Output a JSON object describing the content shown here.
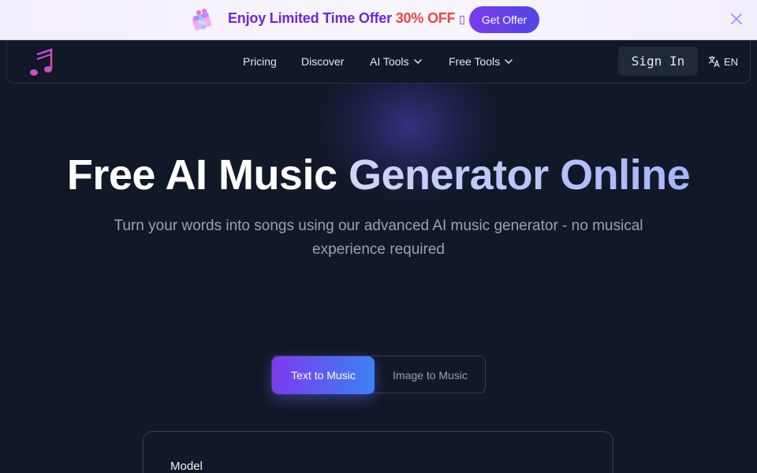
{
  "promo": {
    "text_main": "Enjoy Limited Time Offer ",
    "text_discount": "30% OFF",
    "text_glyph": "▯",
    "button_label": "Get Offer",
    "accent_color": "#6d28d9",
    "discount_color": "#ef4444"
  },
  "nav": {
    "links": [
      {
        "label": "Pricing"
      },
      {
        "label": "Discover"
      },
      {
        "label": "AI Tools"
      },
      {
        "label": "Free Tools"
      }
    ],
    "signin_label": "Sign In",
    "lang_label": "EN"
  },
  "hero": {
    "title_plain": "Free AI Music ",
    "title_gradient": "Generator Online",
    "subtitle": "Turn your words into songs using our advanced AI music generator - no musical experience required"
  },
  "mode_tabs": {
    "items": [
      {
        "label": "Text to Music",
        "active": true
      },
      {
        "label": "Image to Music",
        "active": false
      }
    ]
  },
  "form": {
    "model_label": "Model"
  },
  "colors": {
    "background": "#111827",
    "tab_gradient_start": "#7c3aed",
    "tab_gradient_end": "#3b82f6"
  }
}
